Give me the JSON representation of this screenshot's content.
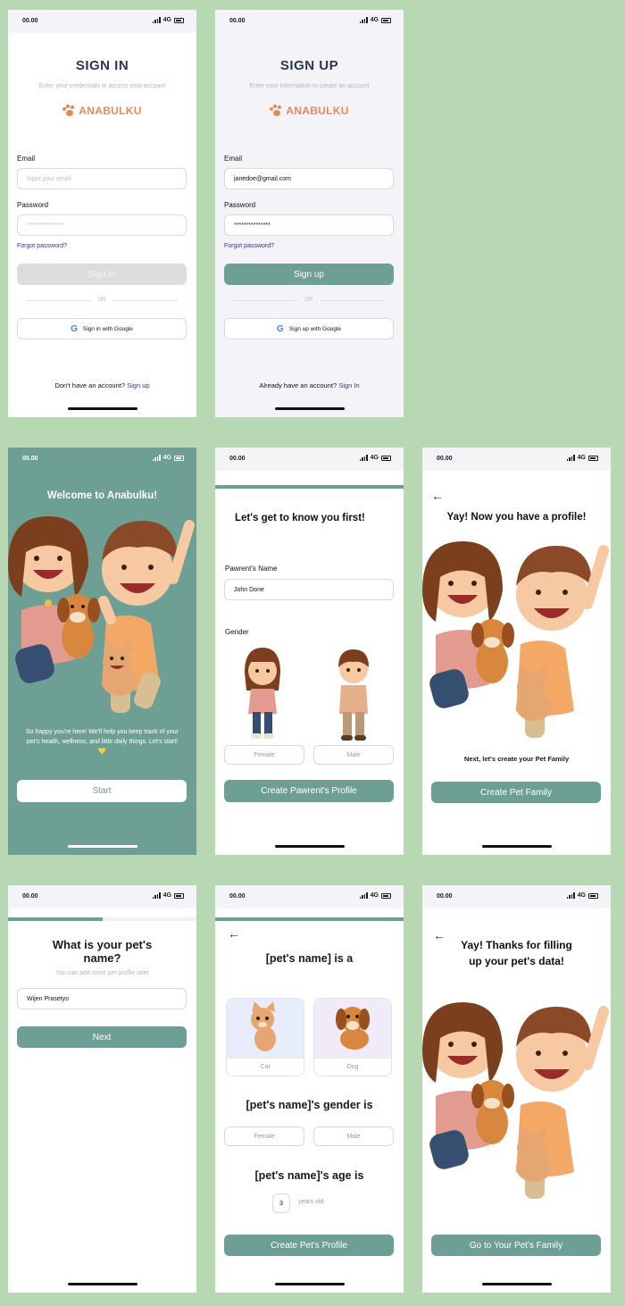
{
  "status": {
    "time": "00.00",
    "network": "4G"
  },
  "signin": {
    "title": "SIGN IN",
    "subtitle": "Enter your credentials to access your account",
    "brand": "ANABULKU",
    "email_label": "Email",
    "email_placeholder": "Input your email",
    "password_label": "Password",
    "password_value": "***************",
    "forgot": "Forgot password?",
    "button": "Sign In",
    "or": "OR",
    "google": "Sign in with Google",
    "footer_text": "Don't have an account?",
    "footer_link": "Sign up"
  },
  "signup": {
    "title": "SIGN UP",
    "subtitle": "Enter your information to create an account",
    "brand": "ANABULKU",
    "email_label": "Email",
    "email_value": "janedoe@gmail.com",
    "password_label": "Password",
    "password_value": "***************",
    "forgot": "Forgot password?",
    "button": "Sign up",
    "or": "OR",
    "google": "Sign up with Google",
    "footer_text": "Already have an account?",
    "footer_link": "Sign In"
  },
  "welcome": {
    "title": "Welcome to Anabulku!",
    "body": "So happy you're here! We'll help you keep track of your pet's health, wellness, and little daily things. Let's start! 💛",
    "button": "Start"
  },
  "know": {
    "title": "Let's get to know you first!",
    "name_label": "Pawrent's Name",
    "name_value": "John Done",
    "gender_label": "Gender",
    "female": "Female",
    "male": "Male",
    "button": "Create Pawrent's Profile"
  },
  "profile": {
    "title": "Yay! Now you have a profile!",
    "text": "Next, let's create your Pet Family",
    "button": "Create Pet Family"
  },
  "petname": {
    "title": "What is your pet's name?",
    "subtitle": "You can add more pet profile later",
    "value": "Wijen Prasetyo",
    "button": "Next",
    "progress": 0.5
  },
  "petinfo": {
    "type_title": "[pet's name] is a",
    "cat": "Cat",
    "dog": "Dog",
    "gender_title": "[pet's name]'s gender is",
    "female": "Female",
    "male": "Male",
    "age_title": "[pet's name]'s age is",
    "age_value": "3",
    "age_unit": "years old",
    "button": "Create Pet's Profile"
  },
  "thanks": {
    "title_line1": "Yay! Thanks for filling",
    "title_line2": "up your pet's data!",
    "button": "Go to Your Pet's Family"
  }
}
